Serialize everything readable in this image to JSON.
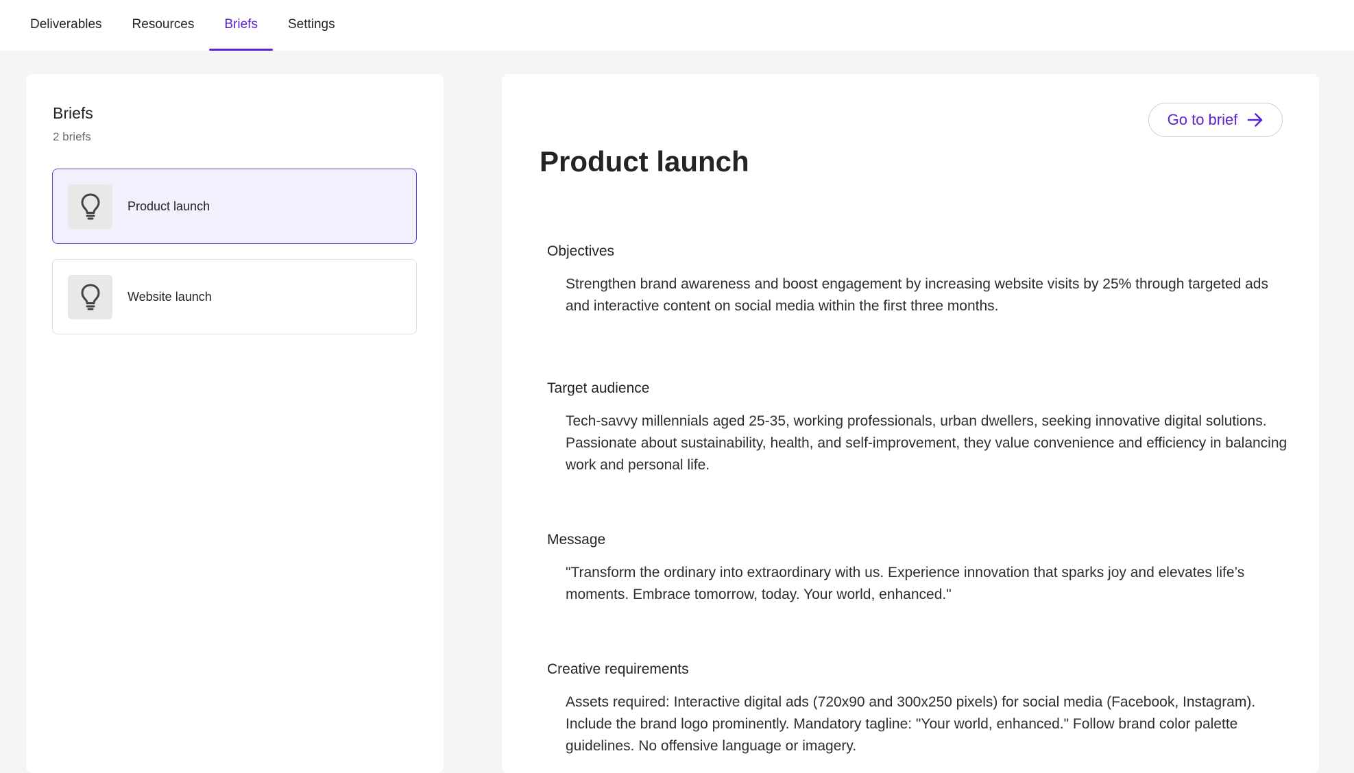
{
  "tabs": [
    {
      "label": "Deliverables"
    },
    {
      "label": "Resources"
    },
    {
      "label": "Briefs"
    },
    {
      "label": "Settings"
    }
  ],
  "active_tab": "Briefs",
  "accent_color": "#5b21d6",
  "left": {
    "title": "Briefs",
    "count": "2 briefs",
    "items": [
      {
        "label": "Product launch",
        "icon": "lightbulb-icon",
        "selected": true
      },
      {
        "label": "Website launch",
        "icon": "lightbulb-icon",
        "selected": false
      }
    ]
  },
  "detail": {
    "go_button": "Go to brief",
    "title": "Product launch",
    "sections": [
      {
        "heading": "Objectives",
        "body": "Strengthen brand awareness and boost engagement by increasing website visits by 25% through targeted ads and interactive content on social media within the first three months."
      },
      {
        "heading": "Target audience",
        "body": "Tech-savvy millennials aged 25-35, working professionals, urban dwellers, seeking innovative digital solutions. Passionate about sustainability, health, and self-improvement, they value convenience and efficiency in balancing work and personal life."
      },
      {
        "heading": "Message",
        "body": "\"Transform the ordinary into extraordinary with us. Experience innovation that sparks joy and elevates life’s moments. Embrace tomorrow, today. Your world, enhanced.\""
      },
      {
        "heading": "Creative requirements",
        "body": "Assets required: Interactive digital ads (720x90 and 300x250 pixels) for social media (Facebook, Instagram). Include the brand logo prominently. Mandatory tagline: \"Your world, enhanced.\" Follow brand color palette guidelines. No offensive language or imagery."
      }
    ]
  }
}
